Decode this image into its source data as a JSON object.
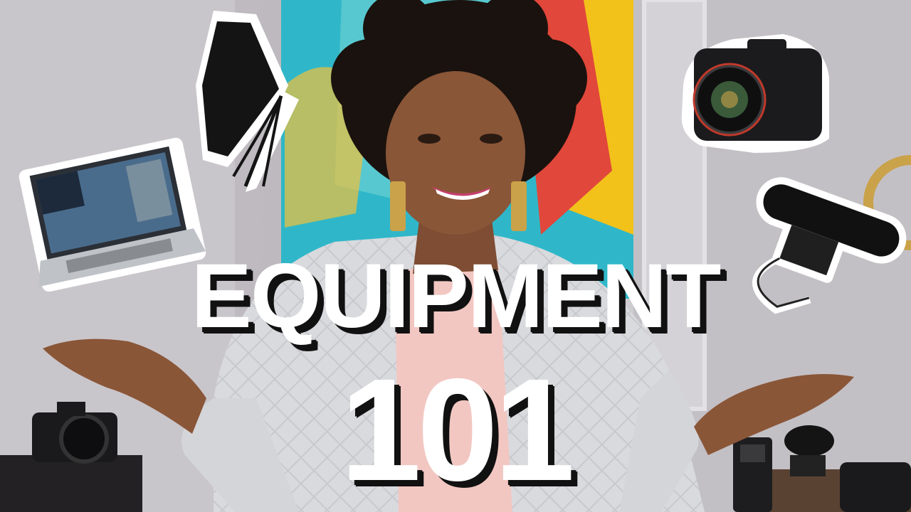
{
  "thumbnail": {
    "title_line1": "EQUIPMENT",
    "title_line2": "101",
    "colors": {
      "title_fill": "#ffffff",
      "title_shadow": "#111111",
      "background_wall": "#c4c1c6",
      "painting_teal": "#2fb7c9",
      "painting_yellow": "#f2c21b",
      "painting_red": "#e1473b",
      "jacket": "#d9dade",
      "shirt": "#f2c7c2",
      "skin": "#8a5638",
      "hair": "#1a120e",
      "lips": "#c63f6e"
    },
    "icons": [
      "laptop-icon",
      "softbox-light-icon",
      "dslr-camera-icon",
      "shotgun-microphone-icon"
    ]
  }
}
